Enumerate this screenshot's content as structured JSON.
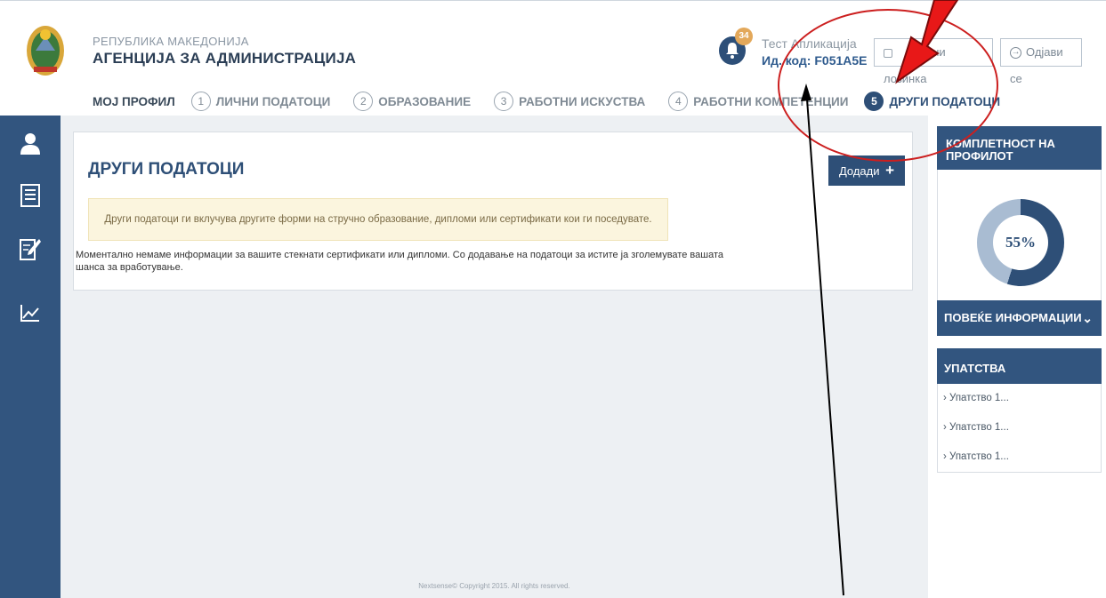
{
  "header": {
    "agency_line1": "РЕПУБЛИКА МАКЕДОНИЈА",
    "agency_line2": "АГЕНЦИЈА ЗА АДМИНИСТРАЦИЈА",
    "notification_count": "34",
    "user_name": "Тест Апликација",
    "user_code": "Ид. код: F051A5E",
    "change_password_label": "ени лозинка",
    "logout_label": "Одјави се"
  },
  "nav": {
    "items": [
      {
        "num": "",
        "label": "МОЈ ПРОФИЛ"
      },
      {
        "num": "1",
        "label": "ЛИЧНИ ПОДАТОЦИ"
      },
      {
        "num": "2",
        "label": "ОБРАЗОВАНИЕ"
      },
      {
        "num": "3",
        "label": "РАБОТНИ ИСКУСТВА"
      },
      {
        "num": "4",
        "label": "РАБОТНИ КОМПЕТЕНЦИИ"
      },
      {
        "num": "5",
        "label": "ДРУГИ ПОДАТОЦИ"
      }
    ]
  },
  "sidebar": {
    "icons": [
      "user-icon",
      "list-icon",
      "edit-document-icon",
      "chart-icon"
    ]
  },
  "main": {
    "title": "ДРУГИ ПОДАТОЦИ",
    "add_button": "Додади",
    "add_icon": "+",
    "notice": "Други податоци ги вклучува другите форми на стручно образование, дипломи или сертификати кои ги поседувате.",
    "info_text": "Моментално немаме информации за вашите стекнати сертификати или дипломи. Со додавање на податоци за истите ја зголемувате вашата шанса за вработување.",
    "footer": "Nextsense© Copyright 2015. All rights reserved."
  },
  "right_panel": {
    "completeness_title": "КОМПЛЕТНОСТ НА ПРОФИЛОТ",
    "completeness_value": "55%",
    "completeness_fraction": 0.55,
    "more_info_label": "ПОВЕЌЕ ИНФОРМАЦИИ",
    "guides_title": "УПАТСТВА",
    "guides": [
      "Упатство 1...",
      "Упатство 1...",
      "Упатство 1..."
    ]
  },
  "colors": {
    "primary": "#2e4f77",
    "sidebar": "#32557f",
    "notice_bg": "#fbf5de",
    "annotation_red": "#cc1f1f"
  }
}
